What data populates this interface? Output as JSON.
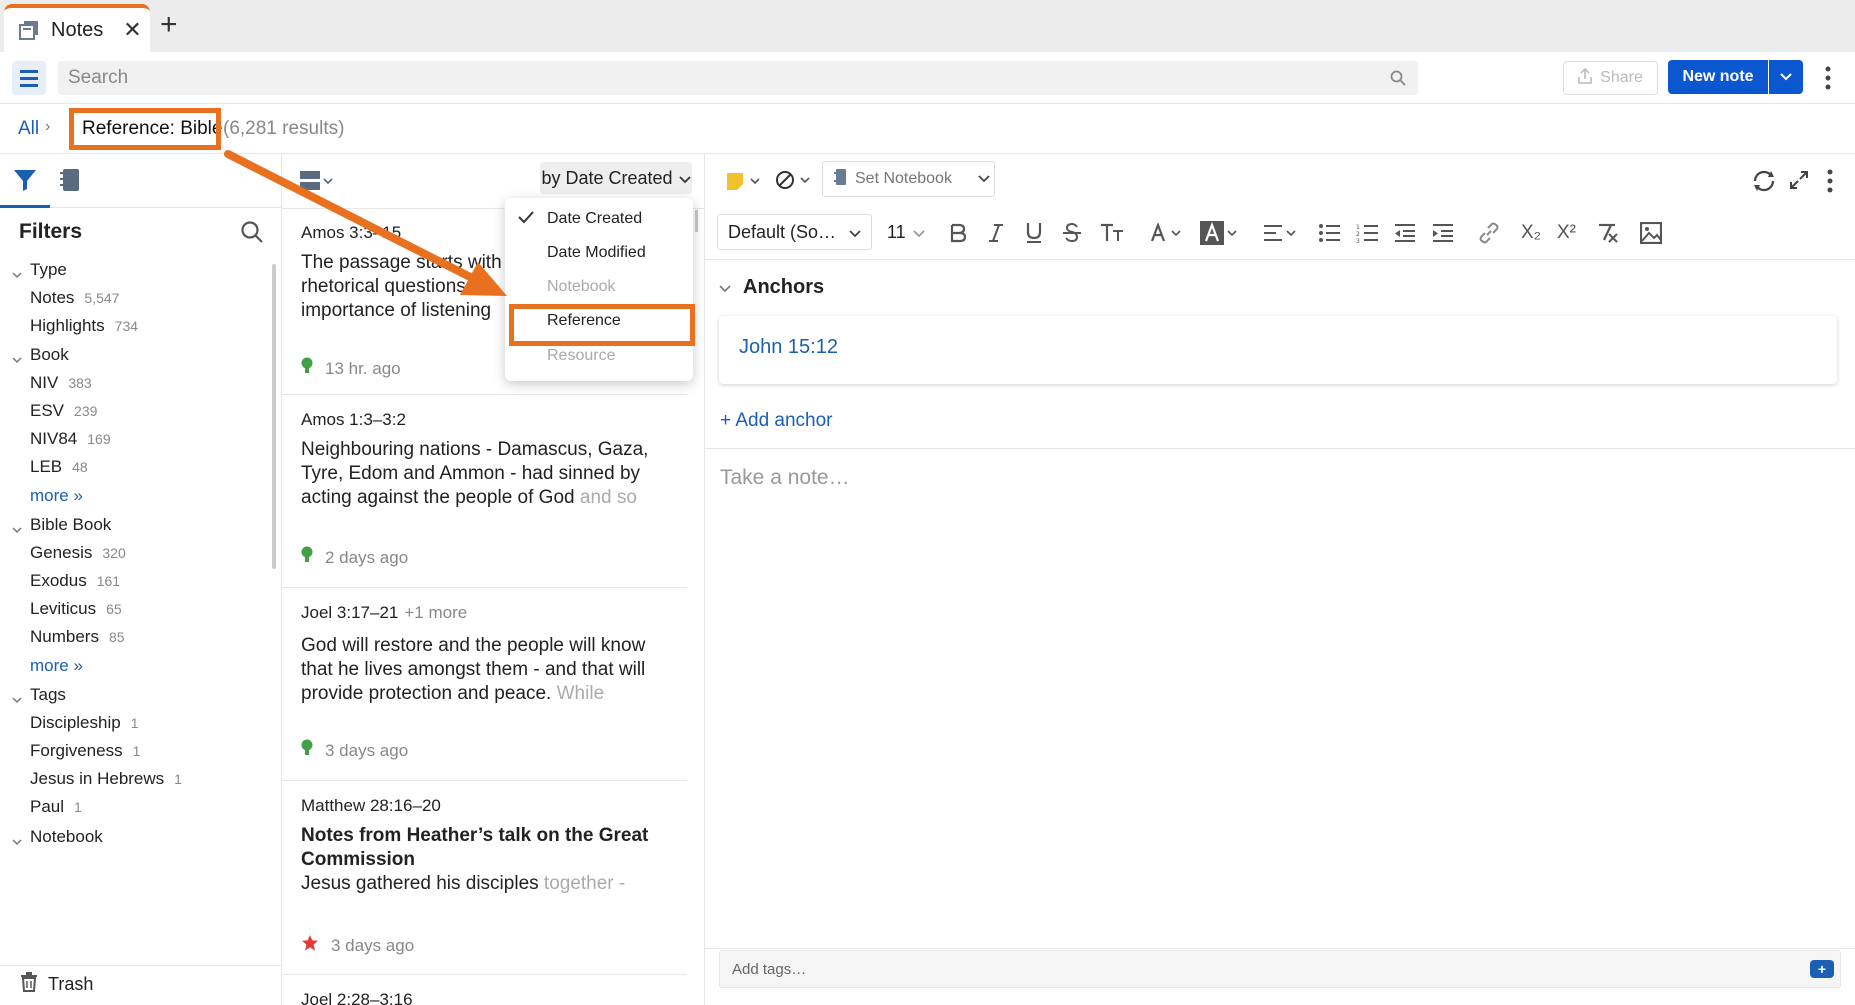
{
  "tab": {
    "label": "Notes"
  },
  "toolbar": {
    "search_placeholder": "Search",
    "share_label": "Share",
    "new_note_label": "New note"
  },
  "breadcrumb": {
    "all_label": "All",
    "sep": "›",
    "filter_label": "Reference: Bible",
    "result_count": "(6,281 results)"
  },
  "filters": {
    "title": "Filters",
    "sections": [
      {
        "label": "Type",
        "items": [
          {
            "label": "Notes",
            "count": "5,547"
          },
          {
            "label": "Highlights",
            "count": "734"
          }
        ]
      },
      {
        "label": "Book",
        "items": [
          {
            "label": "NIV",
            "count": "383"
          },
          {
            "label": "ESV",
            "count": "239"
          },
          {
            "label": "NIV84",
            "count": "169"
          },
          {
            "label": "LEB",
            "count": "48"
          }
        ],
        "more": "more »"
      },
      {
        "label": "Bible Book",
        "items": [
          {
            "label": "Genesis",
            "count": "320"
          },
          {
            "label": "Exodus",
            "count": "161"
          },
          {
            "label": "Leviticus",
            "count": "65"
          },
          {
            "label": "Numbers",
            "count": "85"
          }
        ],
        "more": "more »"
      },
      {
        "label": "Tags",
        "items": [
          {
            "label": "Discipleship",
            "count": "1"
          },
          {
            "label": "Forgiveness",
            "count": "1"
          },
          {
            "label": "Jesus in Hebrews",
            "count": "1"
          },
          {
            "label": "Paul",
            "count": "1"
          }
        ]
      },
      {
        "label": "Notebook"
      }
    ],
    "trash_label": "Trash"
  },
  "notelist": {
    "sort_label": "by Date Created",
    "sort_menu": [
      {
        "label": "Date Created",
        "checked": true,
        "disabled": false
      },
      {
        "label": "Date Modified",
        "checked": false,
        "disabled": false
      },
      {
        "label": "Notebook",
        "checked": false,
        "disabled": true
      },
      {
        "label": "Reference",
        "checked": false,
        "disabled": false
      },
      {
        "label": "Resource",
        "checked": false,
        "disabled": true
      }
    ],
    "notes": [
      {
        "ref": "Amos 3:3–15",
        "more": "",
        "title": "",
        "body": "The passage starts with rhetorical questions - le importance of listening",
        "body_fade": "",
        "time": "13 hr. ago",
        "marker": "bulb"
      },
      {
        "ref": "Amos 1:3–3:2",
        "more": "",
        "title": "",
        "body": "Neighbouring nations - Damascus, Gaza, Tyre, Edom and Ammon - had sinned by acting against the people of God",
        "body_fade": " and so",
        "time": "2 days ago",
        "marker": "bulb"
      },
      {
        "ref": "Joel 3:17–21",
        "more": "+1 more",
        "title": "",
        "body": "God will restore and the people will know that he lives amongst them - and that will provide protection and peace.",
        "body_fade": " While",
        "time": "3 days ago",
        "marker": "bulb"
      },
      {
        "ref": "Matthew 28:16–20",
        "more": "",
        "title": "Notes from Heather’s talk on the Great Commission",
        "body": "Jesus gathered his disciples",
        "body_fade": " together -",
        "time": "3 days ago",
        "marker": "star"
      },
      {
        "ref": "Joel 2:28–3:16",
        "more": "",
        "title": "",
        "body": "",
        "body_fade": "",
        "time": "",
        "marker": ""
      }
    ]
  },
  "editor": {
    "notebook_label": "Set Notebook",
    "font_label": "Default (So…",
    "size_label": "11",
    "anchors_title": "Anchors",
    "anchor_ref": "John 15:12",
    "add_anchor_label": "+ Add anchor",
    "note_placeholder": "Take a note…",
    "tags_placeholder": "Add tags…",
    "fmt_labels": {
      "subscript": "X₂",
      "superscript": "X²"
    }
  },
  "colors": {
    "accent": "#0b57d0",
    "link": "#1a5fb4",
    "annotation": "#e8701e",
    "bulb": "#43a047",
    "star": "#e53935"
  }
}
